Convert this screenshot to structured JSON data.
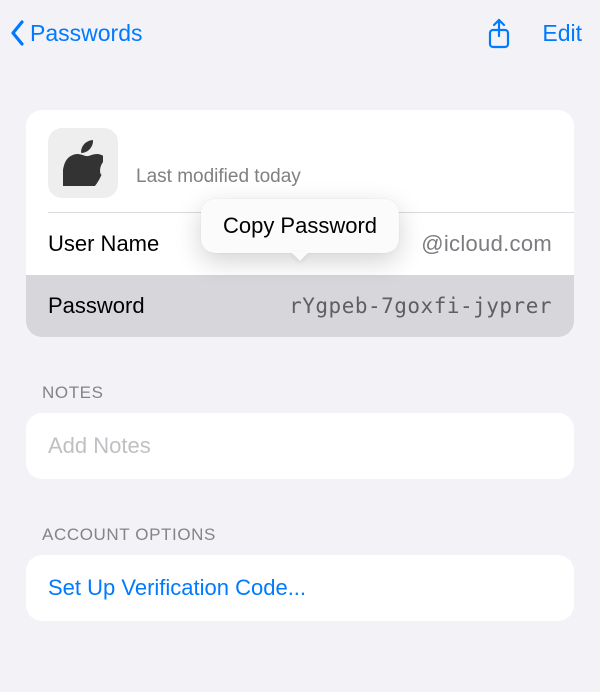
{
  "nav": {
    "back_label": "Passwords",
    "edit_label": "Edit"
  },
  "detail": {
    "last_modified": "Last modified today",
    "username_label": "User Name",
    "username_value": "@icloud.com",
    "password_label": "Password",
    "password_value": "rYgpeb-7goxfi-jyprer"
  },
  "popover": {
    "copy_password": "Copy Password"
  },
  "sections": {
    "notes_header": "NOTES",
    "add_notes": "Add Notes",
    "account_options_header": "ACCOUNT OPTIONS",
    "setup_verification": "Set Up Verification Code..."
  }
}
